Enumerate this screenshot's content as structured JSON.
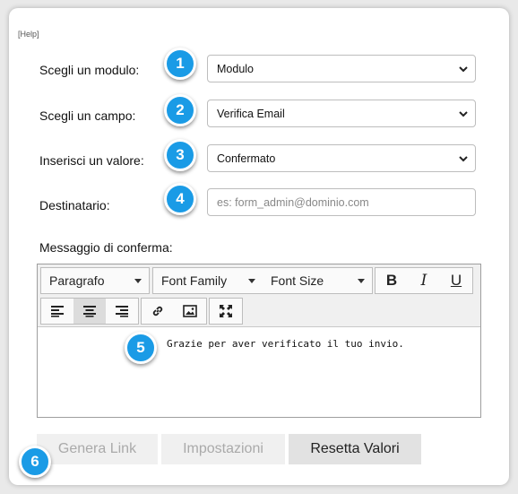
{
  "help_link": "[Help]",
  "fields": {
    "module": {
      "label": "Scegli un modulo:",
      "value": "Modulo",
      "badge": "1"
    },
    "field": {
      "label": "Scegli un campo:",
      "value": "Verifica Email",
      "badge": "2"
    },
    "value": {
      "label": "Inserisci un valore:",
      "value": "Confermato",
      "badge": "3"
    },
    "recipient": {
      "label": "Destinatario:",
      "placeholder": "es: form_admin@dominio.com",
      "badge": "4"
    }
  },
  "message": {
    "label": "Messaggio di conferma:",
    "toolbar": {
      "paragraph": "Paragrafo",
      "font_family": "Font Family",
      "font_size": "Font Size",
      "bold": "B",
      "italic": "I",
      "underline": "U"
    },
    "content": "Grazie per aver verificato il tuo invio.",
    "badge": "5"
  },
  "actions": {
    "generate_link": "Genera Link",
    "settings": "Impostazioni",
    "reset": "Resetta Valori",
    "badge": "6"
  },
  "colors": {
    "badge": "#1a9be6",
    "disabled_text": "#aaaaaa"
  }
}
